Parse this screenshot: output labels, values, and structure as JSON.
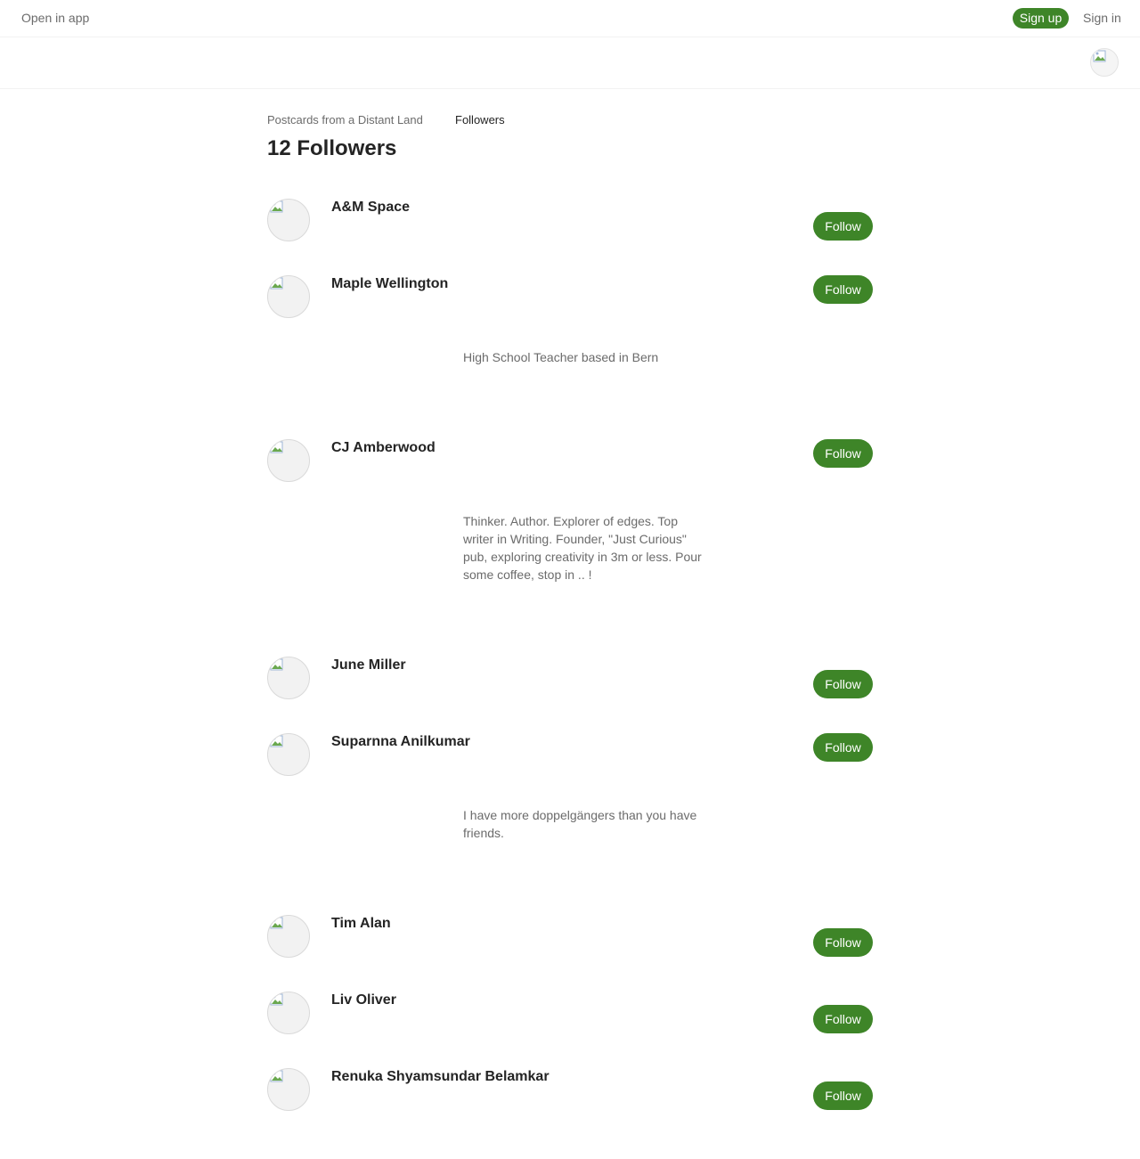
{
  "topbar": {
    "open_in_app": "Open in app",
    "sign_up": "Sign up",
    "sign_in": "Sign in"
  },
  "breadcrumb": {
    "publication": "Postcards from a Distant Land",
    "current": "Followers"
  },
  "page_title": "12 Followers",
  "followers": [
    {
      "name": "A&M Space",
      "bio": "",
      "button": "Follow"
    },
    {
      "name": "Maple Wellington",
      "bio": "High School Teacher based in Bern",
      "button": "Follow"
    },
    {
      "name": "CJ Amberwood",
      "bio": "Thinker. Author. Explorer of edges. Top writer in Writing. Founder, \"Just Curious\" pub, exploring creativity in 3m or less. Pour some coffee, stop in .. !",
      "button": "Follow"
    },
    {
      "name": "June Miller",
      "bio": "",
      "button": "Follow"
    },
    {
      "name": "Suparnna Anilkumar",
      "bio": "I have more doppelgängers than you have friends.",
      "button": "Follow"
    },
    {
      "name": "Tim Alan",
      "bio": "",
      "button": "Follow"
    },
    {
      "name": "Liv Oliver",
      "bio": "",
      "button": "Follow"
    },
    {
      "name": "Renuka Shyamsundar Belamkar",
      "bio": "",
      "button": "Follow"
    }
  ],
  "colors": {
    "accent": "#3e8528",
    "muted_text": "#6b6b6b",
    "primary_text": "#242424"
  }
}
